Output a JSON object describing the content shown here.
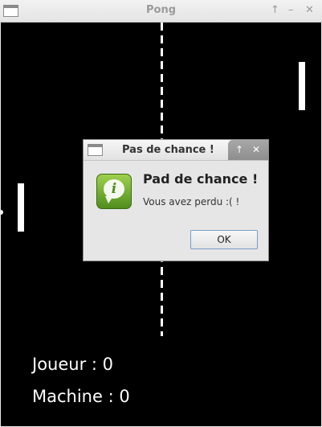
{
  "window": {
    "title": "Pong",
    "restore_glyph": "↑",
    "minimize_glyph": "–",
    "close_glyph": "✕"
  },
  "game": {
    "player_score": "Joueur : 0",
    "machine_score": "Machine : 0"
  },
  "dialog": {
    "title": "Pas de chance !",
    "heading": "Pad de chance !",
    "message": "Vous avez perdu :( !",
    "ok_label": "OK",
    "icon_glyph": "i",
    "restore_glyph": "↑",
    "close_glyph": "✕",
    "icon": "information-icon",
    "icon_color": "#6aa82e"
  }
}
